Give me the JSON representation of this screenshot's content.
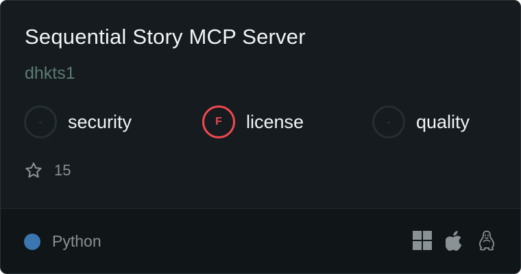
{
  "card": {
    "title": "Sequential Story MCP Server",
    "author": "dhkts1",
    "scores": {
      "security": {
        "label": "security",
        "grade": "-"
      },
      "license": {
        "label": "license",
        "grade": "F"
      },
      "quality": {
        "label": "quality",
        "grade": "-"
      }
    },
    "stars": {
      "count": "15",
      "icon": "star-icon"
    },
    "language": {
      "name": "Python",
      "color": "#3a76b0"
    },
    "platforms": [
      "windows-icon",
      "apple-icon",
      "linux-icon"
    ]
  },
  "colors": {
    "background": "#151b1e",
    "footer_background": "#101517",
    "accent_fail": "#f0484f",
    "author": "#5c7b72"
  }
}
